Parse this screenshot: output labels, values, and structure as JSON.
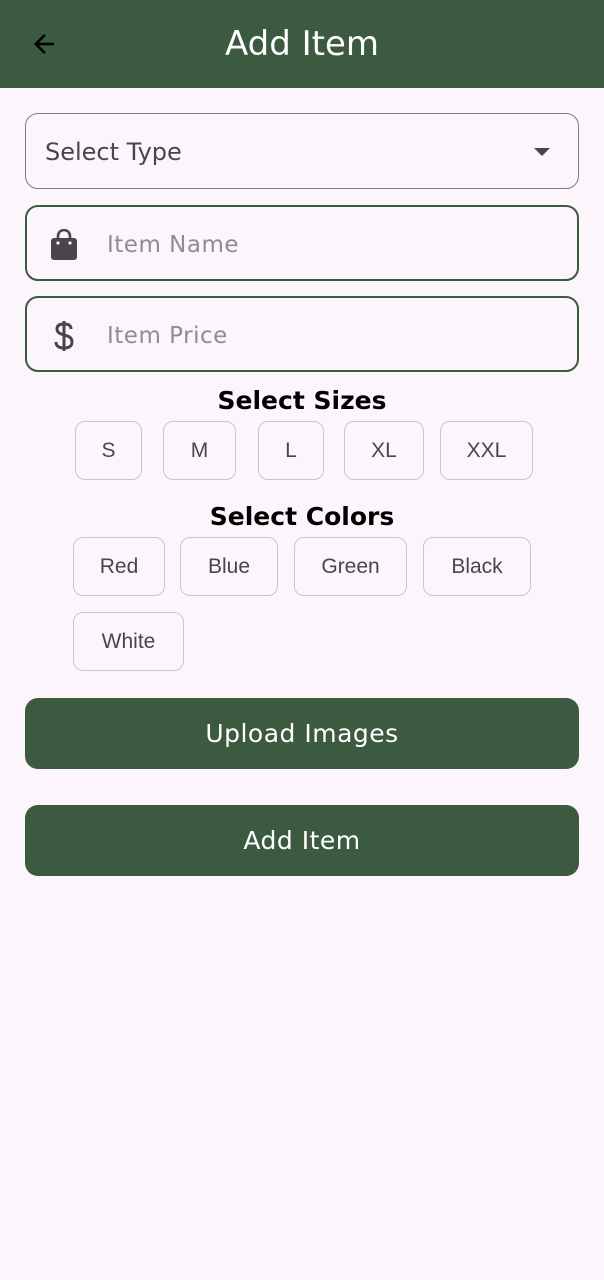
{
  "appbar": {
    "title": "Add Item",
    "back_icon": "arrow-back-icon",
    "background": "#3c5a40"
  },
  "form": {
    "type_select": {
      "value": "Select Type",
      "icon": "dropdown-caret-icon"
    },
    "item_name": {
      "placeholder": "Item Name",
      "value": "",
      "icon": "shopping-bag-icon"
    },
    "item_price": {
      "placeholder": "Item Price",
      "value": "",
      "icon": "dollar-icon"
    }
  },
  "sizes": {
    "title": "Select Sizes",
    "options": [
      "S",
      "M",
      "L",
      "XL",
      "XXL"
    ]
  },
  "colors": {
    "title": "Select Colors",
    "options": [
      "Red",
      "Blue",
      "Green",
      "Black",
      "White"
    ]
  },
  "actions": {
    "upload_label": "Upload Images",
    "submit_label": "Add Item"
  },
  "theme": {
    "primary": "#3c5a40",
    "background": "#fcf6fc",
    "chip_border": "#cac4cf"
  }
}
